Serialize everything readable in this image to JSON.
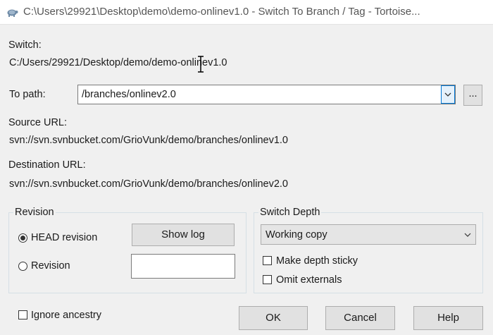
{
  "window": {
    "title": "C:\\Users\\29921\\Desktop\\demo\\demo-onlinev1.0 - Switch To Branch / Tag - Tortoise..."
  },
  "switch": {
    "label": "Switch:",
    "value": "C:/Users/29921/Desktop/demo/demo-onlinev1.0"
  },
  "to_path": {
    "label": "To path:",
    "value": "/branches/onlinev2.0",
    "browse_label": "..."
  },
  "source_url": {
    "label": "Source URL:",
    "value": "svn://svn.svnbucket.com/GrioVunk/demo/branches/onlinev1.0"
  },
  "destination_url": {
    "label": "Destination URL:",
    "value": "svn://svn.svnbucket.com/GrioVunk/demo/branches/onlinev2.0"
  },
  "revision_group": {
    "title": "Revision",
    "head_label": "HEAD revision",
    "revision_label": "Revision",
    "show_log_label": "Show log",
    "revision_value": "",
    "selected": "HEAD revision"
  },
  "depth_group": {
    "title": "Switch Depth",
    "depth_value": "Working copy",
    "sticky_label": "Make depth sticky",
    "omit_label": "Omit externals"
  },
  "footer": {
    "ignore_label": "Ignore ancestry",
    "ok_label": "OK",
    "cancel_label": "Cancel",
    "help_label": "Help"
  }
}
